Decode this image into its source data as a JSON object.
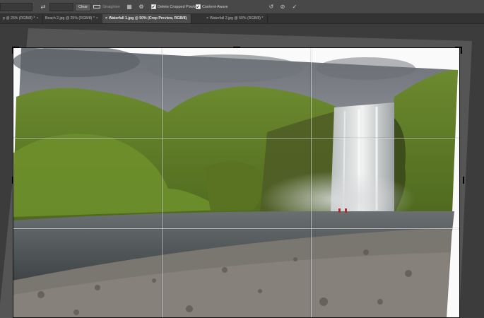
{
  "options": {
    "clear_label": "Clear",
    "straighten_label": "Straighten",
    "delete_cropped_label": "Delete Cropped Pixels",
    "content_aware_label": "Content-Aware",
    "reset_icon": "reset-icon",
    "cancel_icon": "cancel-icon",
    "commit_icon": "check-icon"
  },
  "tabs": [
    {
      "label": "p @ 25% (RGB/8) *",
      "active": false
    },
    {
      "label": "Beach 2.jpg @ 25% (RGB/8) *",
      "active": false
    },
    {
      "label": "Waterfall 1.jpg @ 50% (Crop Preview, RGB/8)",
      "active": true
    },
    {
      "label": "Waterfall 2.jpg @ 50% (RGB/8) *",
      "active": false
    }
  ],
  "colors": {
    "options_bg": "#484848",
    "tabs_bg": "#333333",
    "canvas_bg": "#3c3c3c"
  }
}
